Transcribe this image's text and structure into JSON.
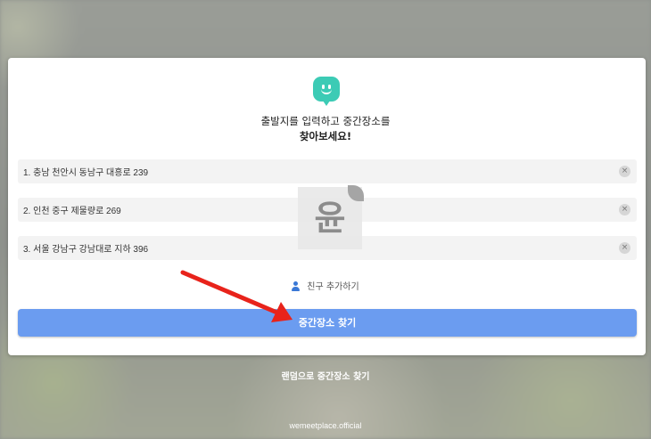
{
  "header": {
    "line1": "출발지를 입력하고 중간장소를",
    "line2": "찾아보세요!"
  },
  "addresses": [
    {
      "label": "1.  충남 천안시 동남구 대흥로 239"
    },
    {
      "label": "2.  인천 중구 제물량로 269"
    },
    {
      "label": "3.  서울 강남구 강남대로 지하 396"
    }
  ],
  "clear_symbol": "×",
  "watermark_text": "윤",
  "add_friend_label": "친구 추가하기",
  "find_button_label": "중간장소 찾기",
  "random_link_label": "랜덤으로 중간장소 찾기",
  "footer_text": "wemeetplace.official",
  "colors": {
    "brand": "#3ccbb5",
    "primary_button": "#6b9cf0",
    "arrow": "#e8231b"
  },
  "icons": [
    "smiley-logo-icon",
    "clear-icon",
    "person-add-icon",
    "arrow-annotation-icon"
  ]
}
